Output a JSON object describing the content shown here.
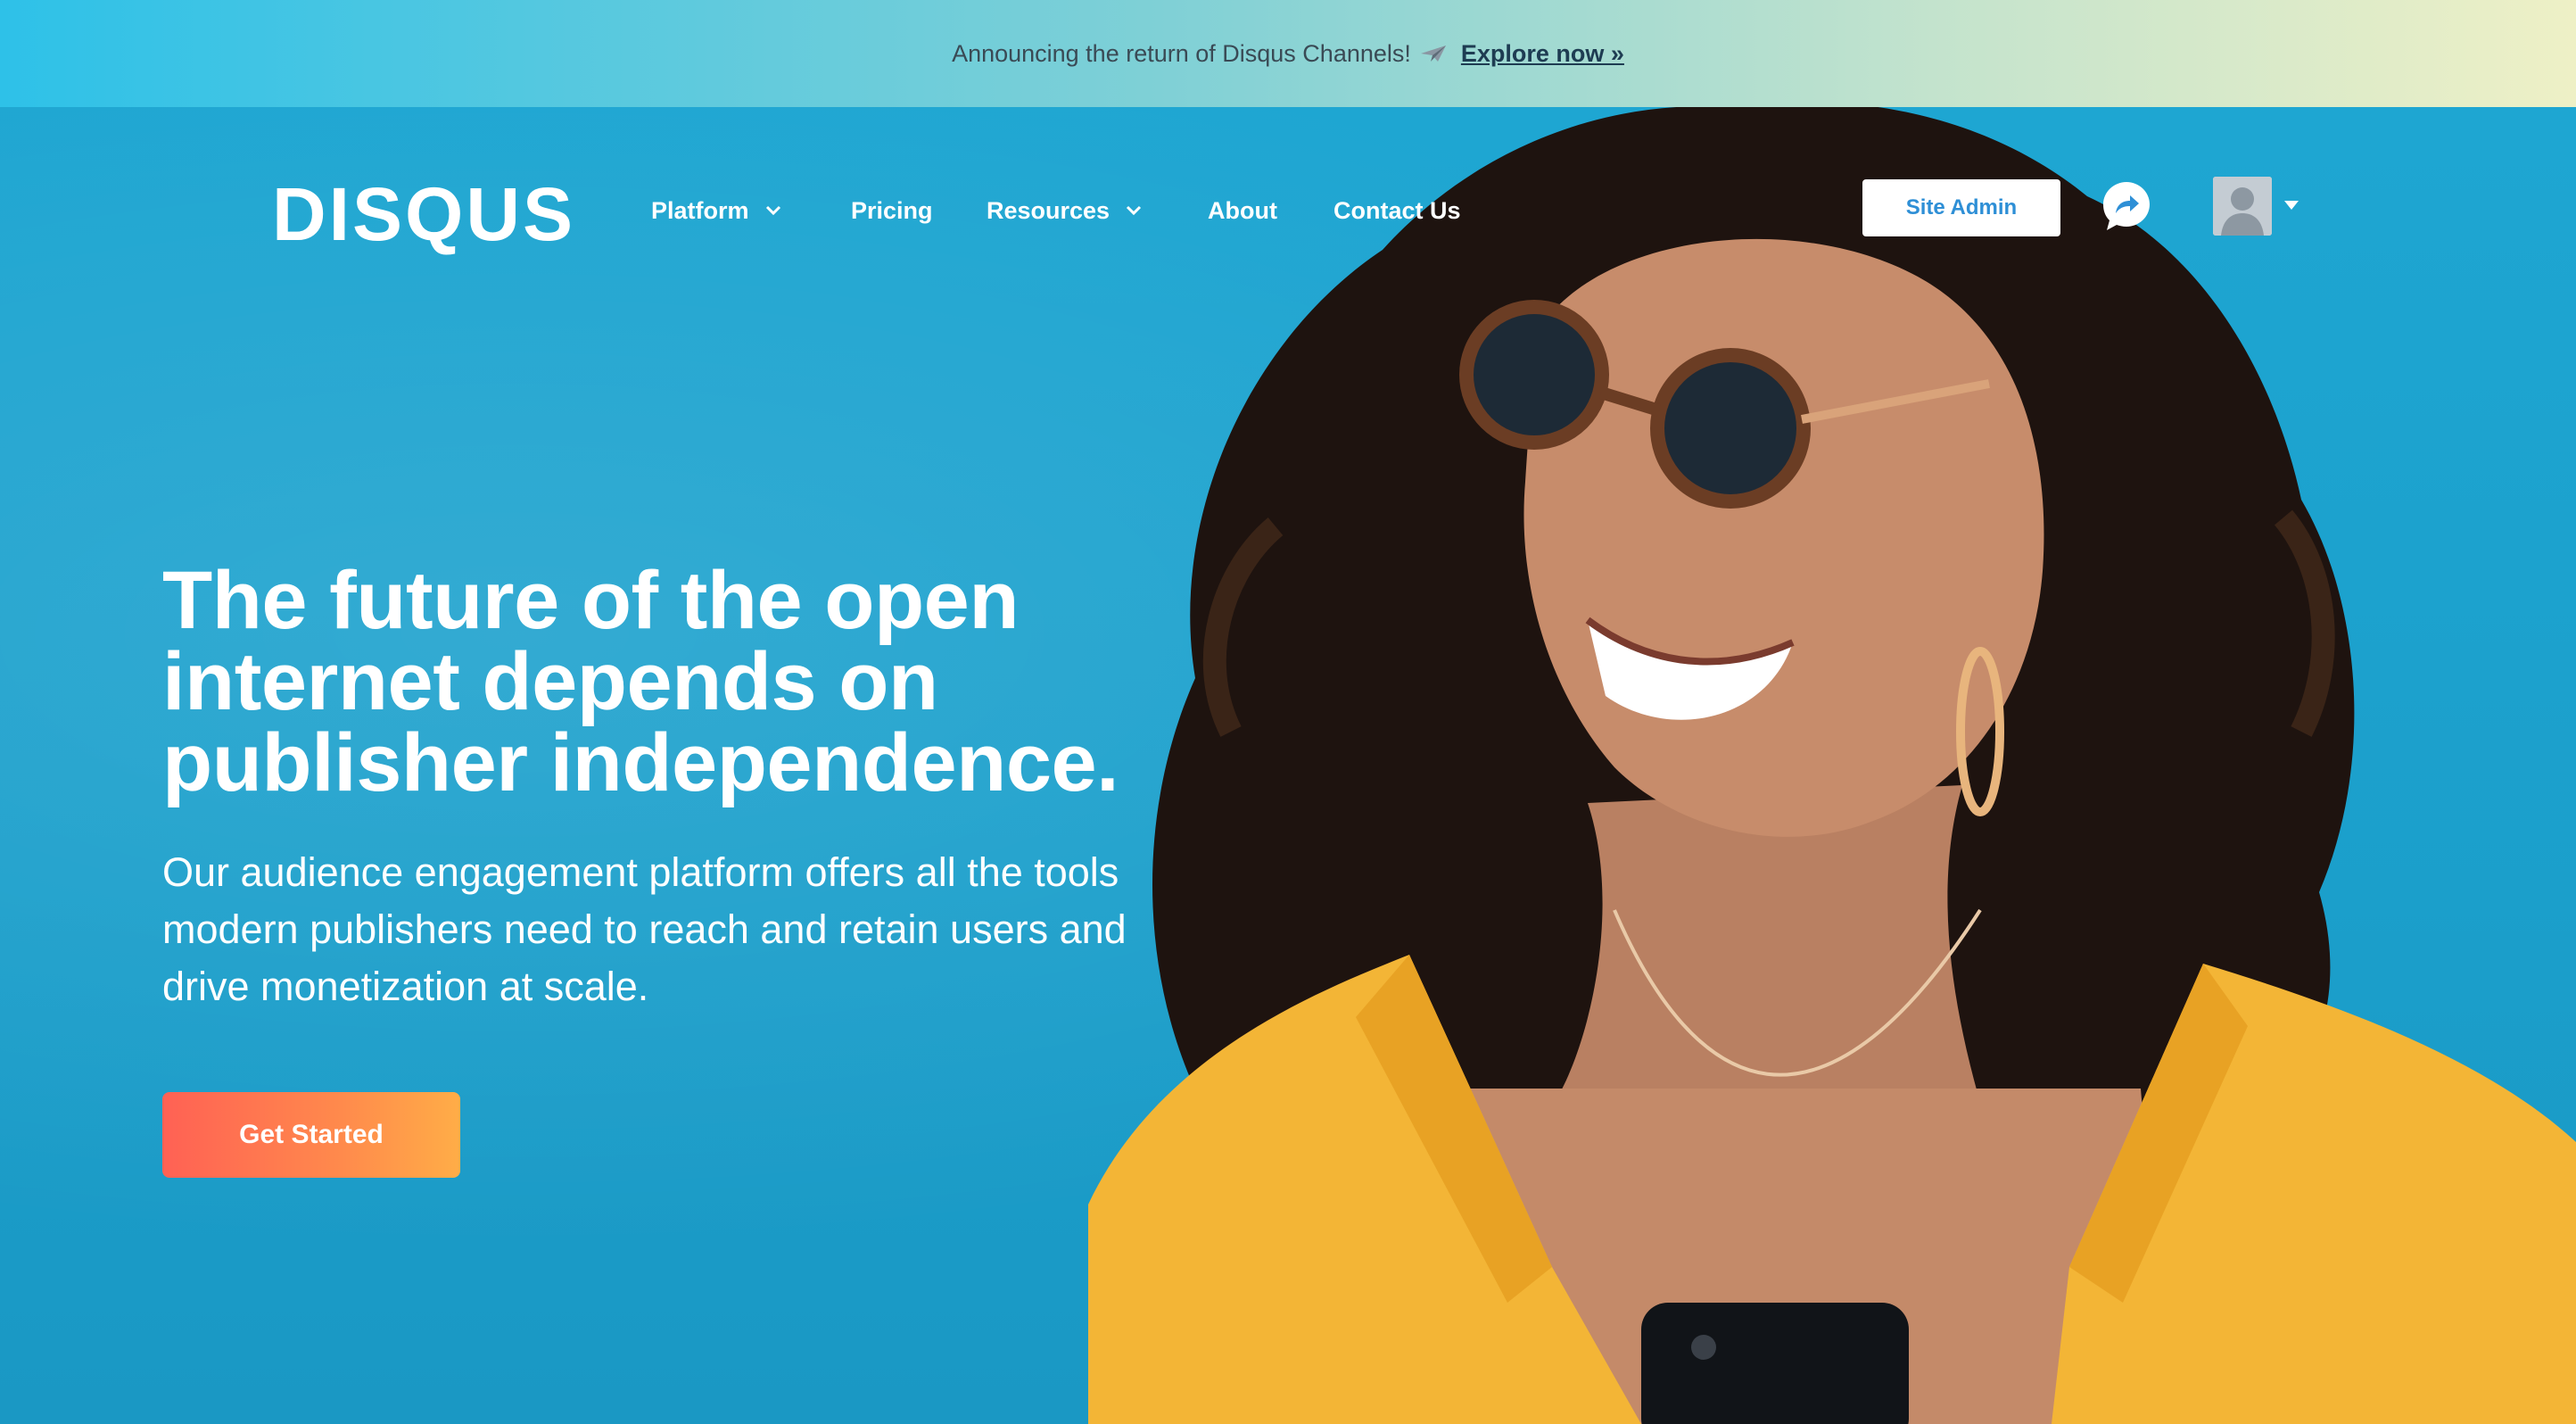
{
  "announcement": {
    "text": "Announcing the return of Disqus Channels!",
    "link_label": "Explore now »"
  },
  "nav": {
    "logo": "DISQUS",
    "items": [
      {
        "label": "Platform",
        "has_dropdown": true
      },
      {
        "label": "Pricing",
        "has_dropdown": false
      },
      {
        "label": "Resources",
        "has_dropdown": true
      },
      {
        "label": "About",
        "has_dropdown": false
      },
      {
        "label": "Contact Us",
        "has_dropdown": false
      }
    ],
    "site_admin_label": "Site Admin"
  },
  "hero": {
    "headline": "The future of the open internet depends on publisher independence.",
    "subcopy": "Our audience engagement platform offers all the tools modern publishers need to reach and retain users and drive monetization at scale.",
    "cta_label": "Get Started"
  },
  "colors": {
    "accent_blue": "#1fa3cf",
    "cta_start": "#ff6154",
    "cta_end": "#ffad47",
    "admin_text": "#2e8fd6"
  },
  "icons": [
    "paper-plane-icon",
    "chevron-down-icon",
    "share-arrow-icon",
    "avatar-icon",
    "caret-down-icon"
  ]
}
